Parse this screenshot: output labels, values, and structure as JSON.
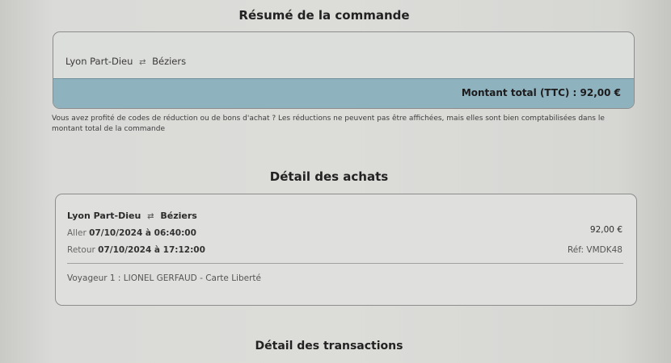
{
  "summary": {
    "title": "Résumé de la commande",
    "route_from": "Lyon Part-Dieu",
    "route_to": "Béziers",
    "route_icon": "round-trip-arrows-icon",
    "total_label": "Montant total (TTC) : 92,00 €",
    "notice": "Vous avez profité de codes de réduction ou de bons d'achat ? Les réductions ne peuvent pas être affichées, mais elles sont bien comptabilisées dans le montant total de la commande"
  },
  "purchases": {
    "title": "Détail des achats",
    "route_from": "Lyon Part-Dieu",
    "route_to": "Béziers",
    "outbound_label": "Aller",
    "outbound_value": "07/10/2024 à 06:40:00",
    "return_label": "Retour",
    "return_value": "07/10/2024 à 17:12:00",
    "price": "92,00 €",
    "reference": "Réf: VMDK48",
    "traveler": "Voyageur 1 : LIONEL GERFAUD - Carte Liberté"
  },
  "transactions": {
    "title": "Détail des transactions"
  },
  "colors": {
    "total_bar": "#8fb2bf",
    "border": "#8b8e8c",
    "background": "#d3d4d1"
  }
}
